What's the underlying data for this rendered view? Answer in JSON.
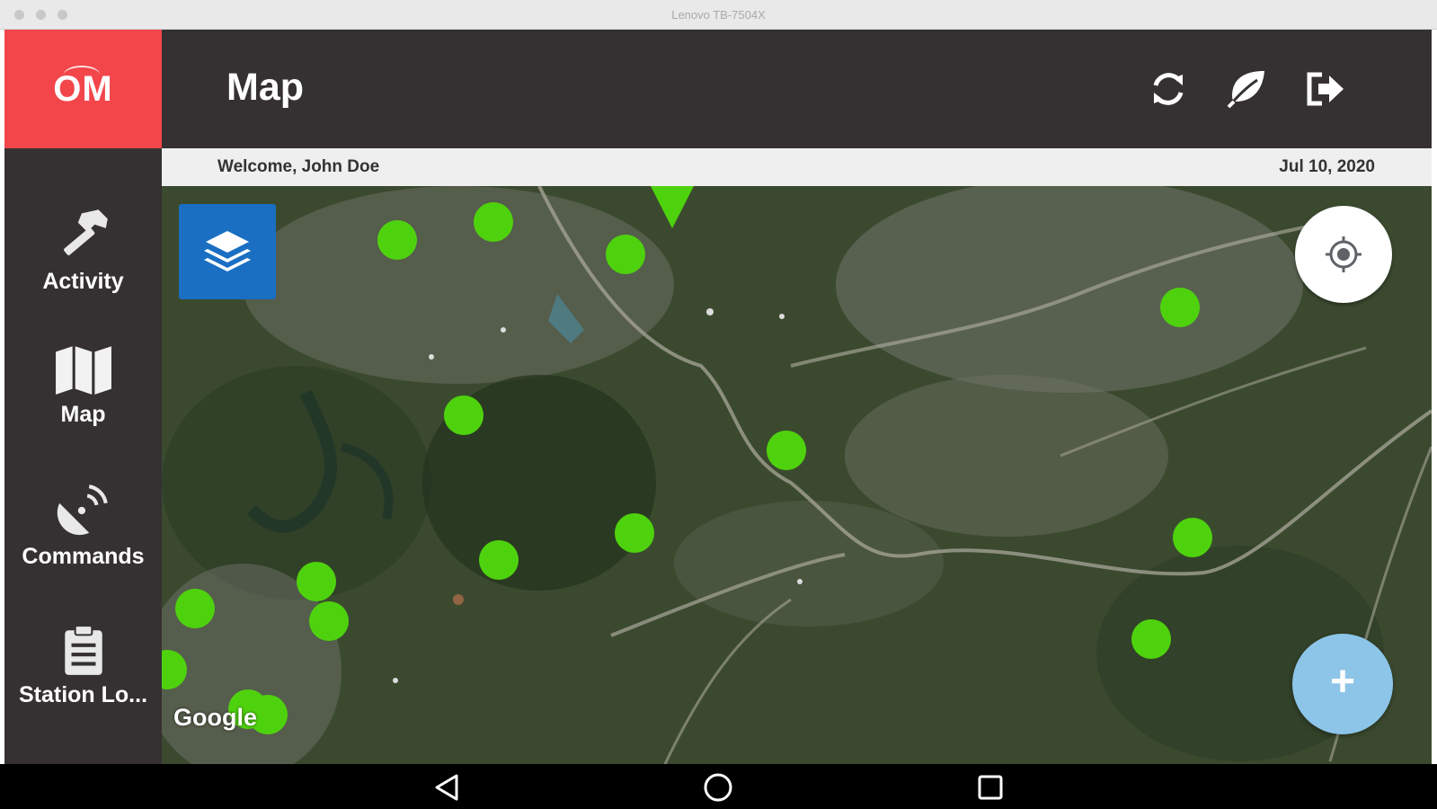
{
  "window": {
    "title": "Lenovo TB-7504X"
  },
  "logo": {
    "text": "OM"
  },
  "sidebar": {
    "items": [
      {
        "label": "Activity",
        "icon": "hammer-icon"
      },
      {
        "label": "Map",
        "icon": "map-icon"
      },
      {
        "label": "Commands",
        "icon": "satellite-dish-icon"
      },
      {
        "label": "Station Lo...",
        "icon": "clipboard-icon"
      }
    ]
  },
  "header": {
    "title": "Map",
    "actions": [
      {
        "icon": "sync-icon"
      },
      {
        "icon": "leaf-icon"
      },
      {
        "icon": "logout-icon"
      }
    ]
  },
  "welcome_bar": {
    "welcome": "Welcome, John Doe",
    "date": "Jul 10, 2020"
  },
  "map": {
    "attribution": "Google",
    "add_button_label": "+",
    "layers_icon": "layers-icon",
    "locate_icon": "crosshair-icon"
  },
  "system_nav": {
    "icons": [
      "back-icon",
      "home-icon",
      "recents-icon"
    ]
  },
  "colors": {
    "accent": "#f2464b",
    "chrome": "#353132",
    "marker": "#4fd20e",
    "layers_button": "#1a6fc2",
    "fab": "#8cc5e8"
  }
}
